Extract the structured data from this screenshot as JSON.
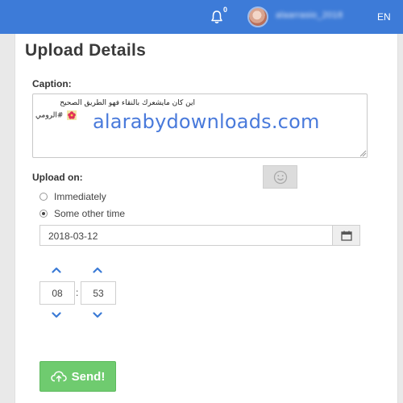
{
  "nav": {
    "notification_count": "0",
    "username": "alaarrasio_2018",
    "language": "EN"
  },
  "page": {
    "title": "Upload Details"
  },
  "caption": {
    "label": "Caption:",
    "line1": "اين كان مايشعرك بالنقاء فهو الطريق الصحيح",
    "line2": "الرومي#"
  },
  "watermark": {
    "text": "alarabydownloads.com"
  },
  "upload_on": {
    "label": "Upload on:",
    "options": [
      {
        "label": "Immediately",
        "selected": false
      },
      {
        "label": "Some other time",
        "selected": true
      }
    ],
    "date_value": "2018-03-12",
    "hour": "08",
    "minute": "53",
    "separator": ":"
  },
  "send_button": {
    "label": "Send!"
  },
  "colors": {
    "nav_bg": "#3d7bd8",
    "accent_blue": "#3a7ad6",
    "send_green": "#6fcb6f"
  },
  "icons": {
    "notification": "bell-icon",
    "emoji": "smiley-icon",
    "calendar": "calendar-icon",
    "send": "cloud-upload-icon",
    "increment": "chevron-up-icon",
    "decrement": "chevron-down-icon"
  }
}
